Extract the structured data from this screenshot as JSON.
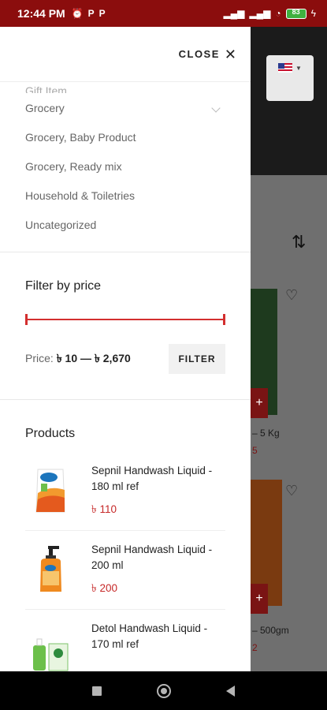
{
  "status_bar": {
    "time": "12:44 PM",
    "left_icons": [
      "alarm-icon",
      "p-icon",
      "p-icon"
    ],
    "right_icons": [
      "signal-icon",
      "signal-icon",
      "wifi-icon"
    ],
    "battery": "83"
  },
  "drawer": {
    "close_label": "CLOSE",
    "close_glyph": "✕",
    "categories": [
      {
        "label": "Gift Item"
      },
      {
        "label": "Grocery",
        "expandable": true
      },
      {
        "label": "Grocery, Baby Product"
      },
      {
        "label": "Grocery, Ready mix"
      },
      {
        "label": "Household & Toiletries"
      },
      {
        "label": "Uncategorized"
      }
    ],
    "price_filter": {
      "title": "Filter by price",
      "label": "Price:",
      "range_text": "৳ 10 — ৳ 2,670",
      "button_label": "FILTER",
      "range_fraction": [
        0,
        1
      ]
    },
    "products": {
      "title": "Products",
      "items": [
        {
          "name": "Sepnil Handwash Liquid - 180 ml ref",
          "price": "৳ 110",
          "image": "handwash-refill-pouch"
        },
        {
          "name": "Sepnil Handwash Liquid - 200 ml",
          "price": "৳ 200",
          "image": "handwash-pump-bottle"
        },
        {
          "name": "Detol Handwash Liquid - 170 ml ref",
          "price": "",
          "image": "dettol-handwash-pack"
        }
      ]
    }
  },
  "background": {
    "sort_glyph": "⇅",
    "plus_glyph": "+",
    "heart_glyph": "♡",
    "item_1_text": "– 5 Kg",
    "item_1_price": "5",
    "item_2_text": "– 500gm",
    "item_2_price": "2"
  },
  "colors": {
    "accent": "#d32f2f",
    "status_bar": "#8b0d0d",
    "price": "#c62828"
  }
}
